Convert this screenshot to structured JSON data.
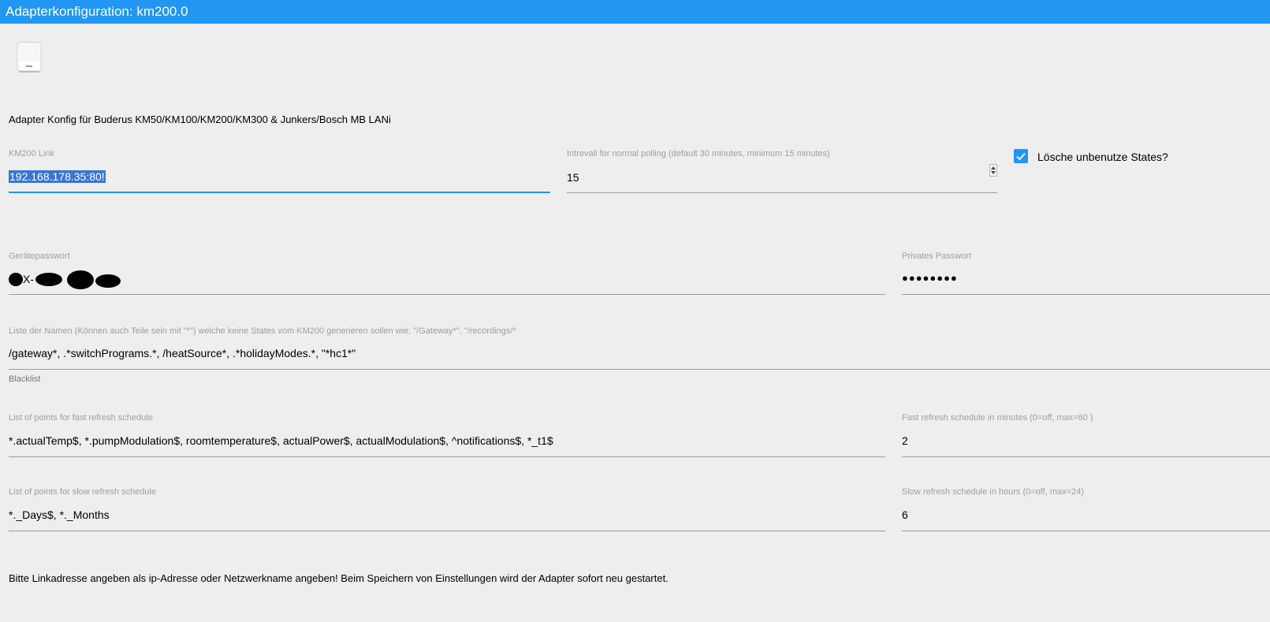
{
  "window": {
    "title": "Adapterkonfiguration: km200.0"
  },
  "logo": {
    "icon": "heating-device-icon"
  },
  "intro_text": "Adapter Konfig für Buderus KM50/KM100/KM200/KM300 & Junkers/Bosch MB LANi",
  "km200_link": {
    "label": "KM200 Link",
    "value": "192.168.178.35:80!"
  },
  "interval": {
    "label": "Intrevall for normal polling (default 30 minutes, minimum 15 minutes)",
    "value": "15"
  },
  "delete_unused": {
    "label": "Lösche unbenutze States?",
    "checked": true
  },
  "device_password": {
    "label": "Gerätepasswort",
    "value_visible": "X-"
  },
  "private_password": {
    "label": "Privates Passwort",
    "value": "●●●●●●●●"
  },
  "blacklist": {
    "label": "Liste der Namen (Können auch Teile sein mit \"*\") welche keine States vom KM200 generieren sollen wie: \"/Gateway*\", \"/recordings/*",
    "value": "/gateway*,  .*switchPrograms.*, /heatSource*, .*holidayModes.*, \"*hc1*\"",
    "helper": "Blacklist"
  },
  "fast_points": {
    "label": "List of points for fast refresh schedule",
    "value": "*.actualTemp$, *.pumpModulation$, roomtemperature$, actualPower$, actualModulation$, ^notifications$, *_t1$"
  },
  "fast_minutes": {
    "label": "Fast refresh schedule in minutes (0=off, max=60 )",
    "value": "2"
  },
  "slow_points": {
    "label": "List of points for slow refresh schedule",
    "value": "*._Days$, *._Months"
  },
  "slow_hours": {
    "label": "Slow refresh schedule in hours (0=off, max=24)",
    "value": "6"
  },
  "footer_text": "Bitte Linkadresse angeben als ip-Adresse oder Netzwerkname angeben! Beim Speichern von Einstellungen wird der Adapter sofort neu gestartet.",
  "colors": {
    "accent": "#2196f3",
    "background": "#efeeee",
    "label": "#9e9e9e"
  }
}
